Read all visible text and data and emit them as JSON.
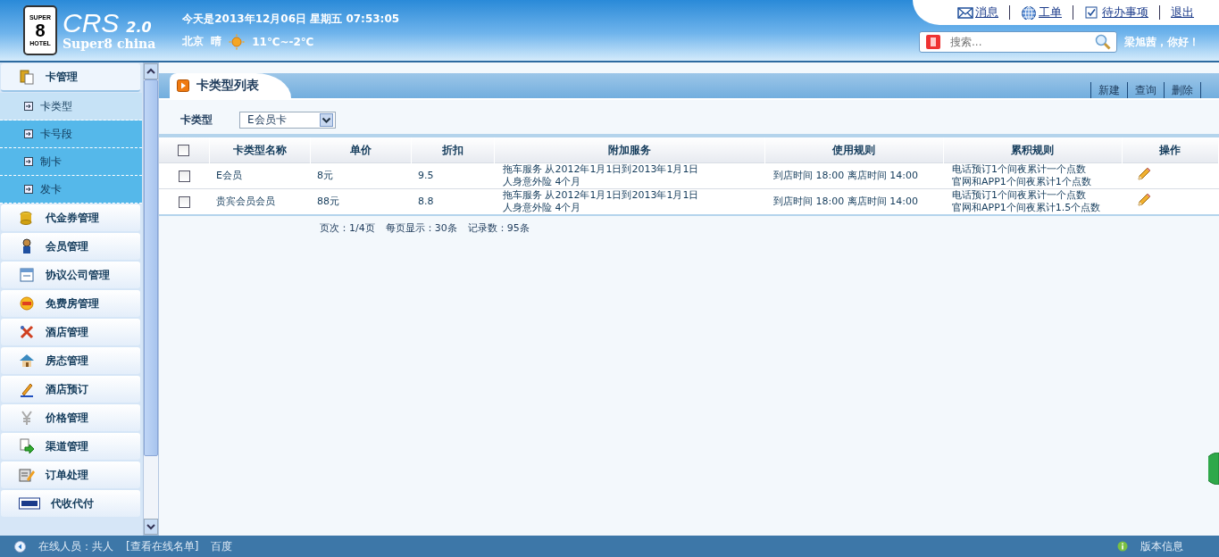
{
  "header": {
    "logo": {
      "badge_top": "SUPER",
      "badge_mid": "8",
      "badge_bottom": "HOTEL",
      "brand": "CRS",
      "version": "2.0",
      "subtitle": "Super8 china"
    },
    "date_line": "今天是2013年12月06日  星期五  07:53:05",
    "weather": {
      "city": "北京",
      "condition": "晴",
      "temperature": "11℃~-2℃"
    },
    "top_links": [
      {
        "label": "消息"
      },
      {
        "label": "工单"
      },
      {
        "label": "待办事项"
      },
      {
        "label": "退出"
      }
    ],
    "search": {
      "placeholder": "搜索..."
    },
    "greeting": "梁旭茜，你好！"
  },
  "sidebar": {
    "groups": [
      {
        "label": "卡管理",
        "expanded": true,
        "children": [
          {
            "label": "卡类型",
            "selected": true
          },
          {
            "label": "卡号段",
            "selected": false
          },
          {
            "label": "制卡",
            "selected": false
          },
          {
            "label": "发卡",
            "selected": false
          }
        ]
      },
      {
        "label": "代金券管理",
        "expanded": false
      },
      {
        "label": "会员管理",
        "expanded": false
      },
      {
        "label": "协议公司管理",
        "expanded": false
      },
      {
        "label": "免费房管理",
        "expanded": false
      },
      {
        "label": "酒店管理",
        "expanded": false
      },
      {
        "label": "房态管理",
        "expanded": false
      },
      {
        "label": "酒店预订",
        "expanded": false
      },
      {
        "label": "价格管理",
        "expanded": false
      },
      {
        "label": "渠道管理",
        "expanded": false
      },
      {
        "label": "订单处理",
        "expanded": false
      },
      {
        "label": "代收代付",
        "expanded": false
      }
    ]
  },
  "main": {
    "tab_title": "卡类型列表",
    "actions": [
      "新建",
      "查询",
      "删除"
    ],
    "filter": {
      "label": "卡类型",
      "value": "E会员卡"
    },
    "table": {
      "header_checked": false,
      "columns": [
        "卡类型名称",
        "单价",
        "折扣",
        "附加服务",
        "使用规则",
        "累积规则",
        "操作"
      ],
      "rows": [
        {
          "checked": false,
          "cells": [
            [
              "E会员"
            ],
            [
              "8元"
            ],
            [
              "9.5"
            ],
            [
              "拖车服务 从2012年1月1日到2013年1月1日",
              "人身意外险 4个月"
            ],
            [
              "到店时间 18:00 离店时间 14:00"
            ],
            [
              "电话预订1个间夜累计一个点数",
              "官网和APP1个间夜累计1个点数"
            ]
          ]
        },
        {
          "checked": false,
          "cells": [
            [
              "贵宾会员会员"
            ],
            [
              "88元"
            ],
            [
              "8.8"
            ],
            [
              "拖车服务 从2012年1月1日到2013年1月1日",
              "人身意外险 4个月"
            ],
            [
              "到店时间 18:00 离店时间 14:00"
            ],
            [
              "电话预订1个间夜累计一个点数",
              "官网和APP1个间夜累计1.5个点数"
            ]
          ]
        }
      ]
    },
    "pager": [
      "页次：1/4页",
      "每页显示：30条",
      "记录数：95条"
    ]
  },
  "status_bar": {
    "online": "在线人员：共人",
    "online_list_link": "[查看在线名单]",
    "link": "百度",
    "version": "版本信息"
  }
}
